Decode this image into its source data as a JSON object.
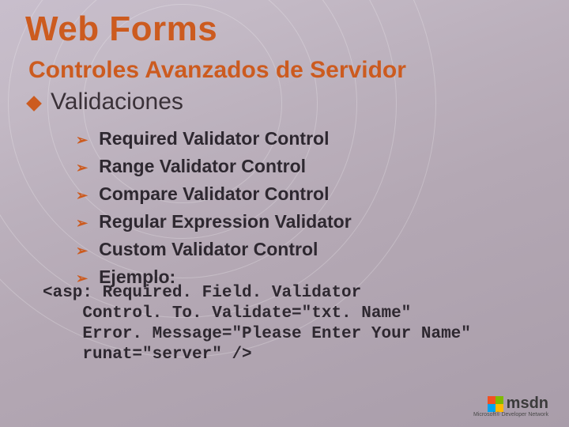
{
  "title": "Web Forms",
  "subtitle": "Controles Avanzados de Servidor",
  "section": "Validaciones",
  "bullets": [
    "Required Validator Control",
    "Range Validator Control",
    "Compare Validator Control",
    "Regular Expression Validator",
    "Custom Validator Control",
    "Ejemplo:"
  ],
  "code": "<asp: Required. Field. Validator\n    Control. To. Validate=\"txt. Name\"\n    Error. Message=\"Please Enter Your Name\"\n    runat=\"server\" />",
  "logo": {
    "text": "msdn",
    "sub": "Microsoft® Developer Network"
  }
}
